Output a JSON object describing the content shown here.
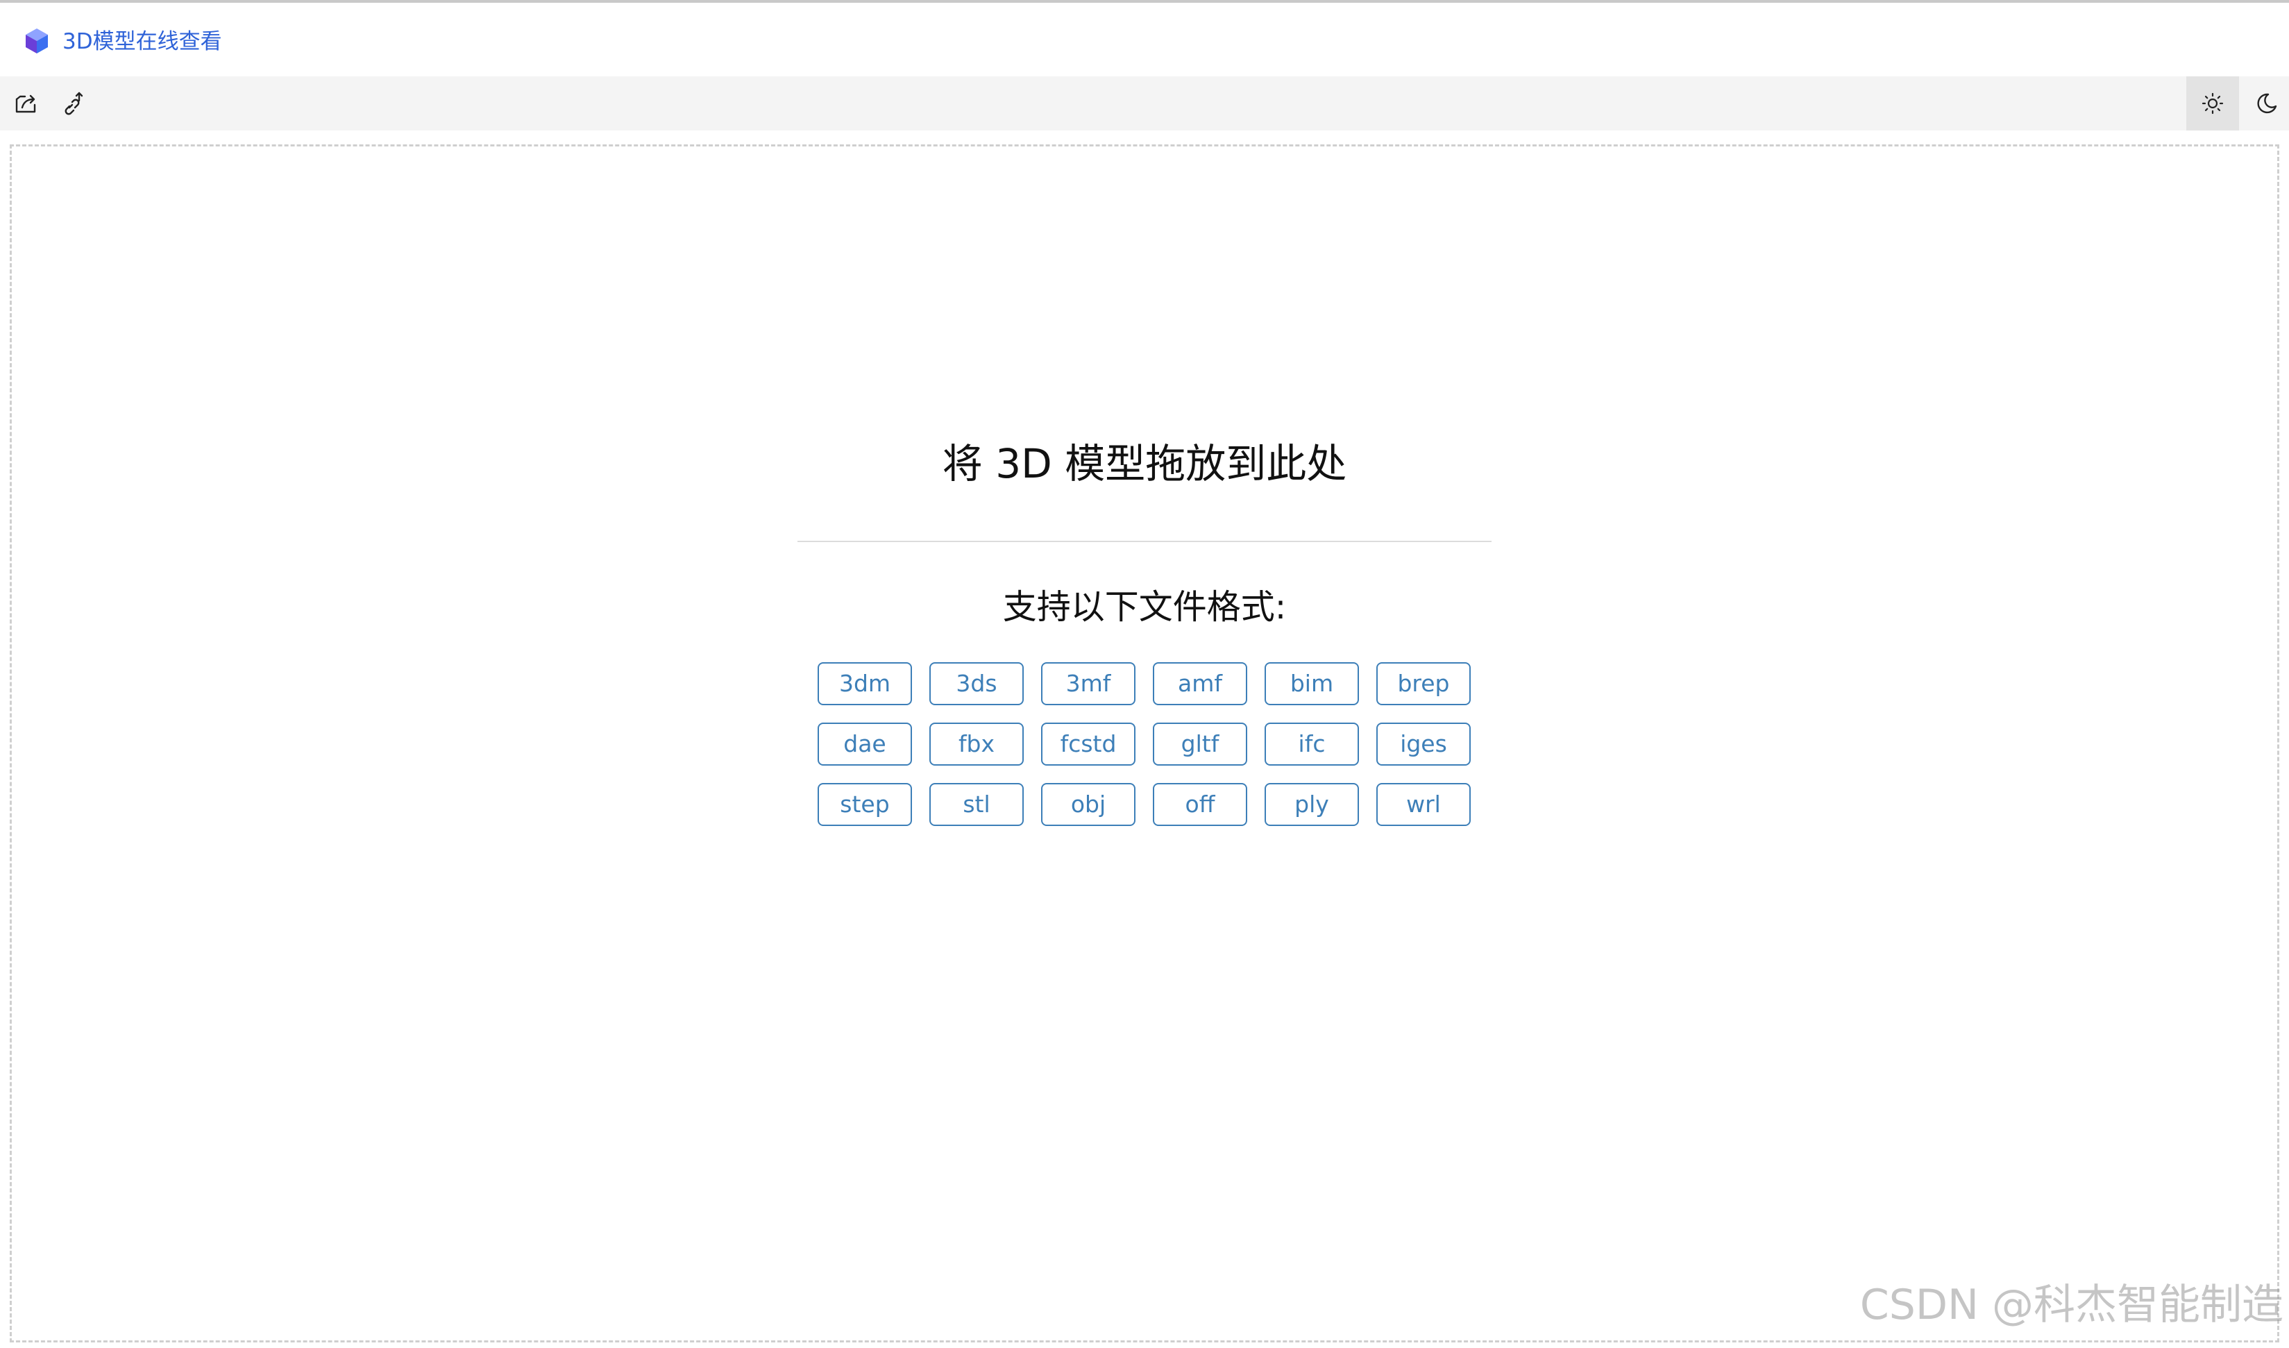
{
  "app": {
    "title": "3D模型在线查看",
    "logo_icon": "cube-logo-icon"
  },
  "toolbar": {
    "left": [
      {
        "name": "open-file-icon"
      },
      {
        "name": "open-url-icon"
      }
    ],
    "right": [
      {
        "name": "light-theme-icon",
        "active": true
      },
      {
        "name": "dark-theme-icon",
        "active": false
      }
    ]
  },
  "drop": {
    "title": "将 3D 模型拖放到此处",
    "formats_title": "支持以下文件格式:",
    "formats": [
      "3dm",
      "3ds",
      "3mf",
      "amf",
      "bim",
      "brep",
      "dae",
      "fbx",
      "fcstd",
      "gltf",
      "ifc",
      "iges",
      "step",
      "stl",
      "obj",
      "off",
      "ply",
      "wrl"
    ]
  },
  "colors": {
    "accent": "#2f63d8",
    "tag": "#3d7fb8"
  },
  "watermark": "CSDN @科杰智能制造"
}
